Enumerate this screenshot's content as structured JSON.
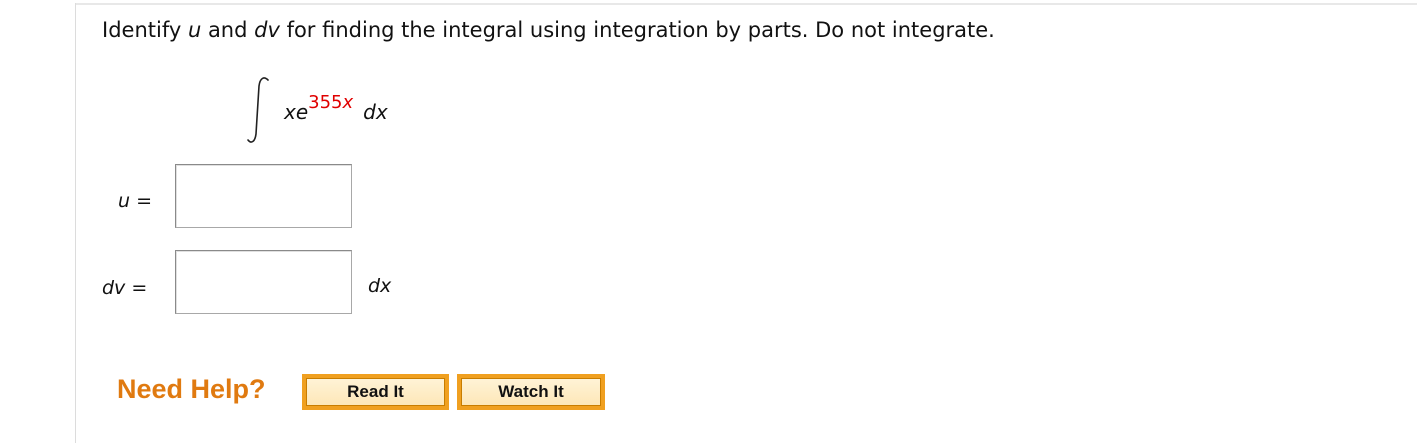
{
  "question": {
    "part1": "Identify ",
    "var_u": "u",
    "part2": " and ",
    "var_dv": "dv",
    "part3": " for finding the integral using integration by parts. Do not integrate."
  },
  "integral": {
    "base": "xe",
    "exponent_number": "355",
    "exponent_var": "x",
    "differential": "dx"
  },
  "fields": {
    "u_label_var": "u",
    "u_label_eq": " =",
    "u_value": "",
    "dv_label_var": "dv",
    "dv_label_eq": " =",
    "dv_value": "",
    "dv_suffix": "dx"
  },
  "help": {
    "title": "Need Help?",
    "read_label": "Read It",
    "watch_label": "Watch It"
  },
  "colors": {
    "accent_orange": "#f0a020",
    "help_text": "#e07a10",
    "exponent_red": "#e00000"
  }
}
